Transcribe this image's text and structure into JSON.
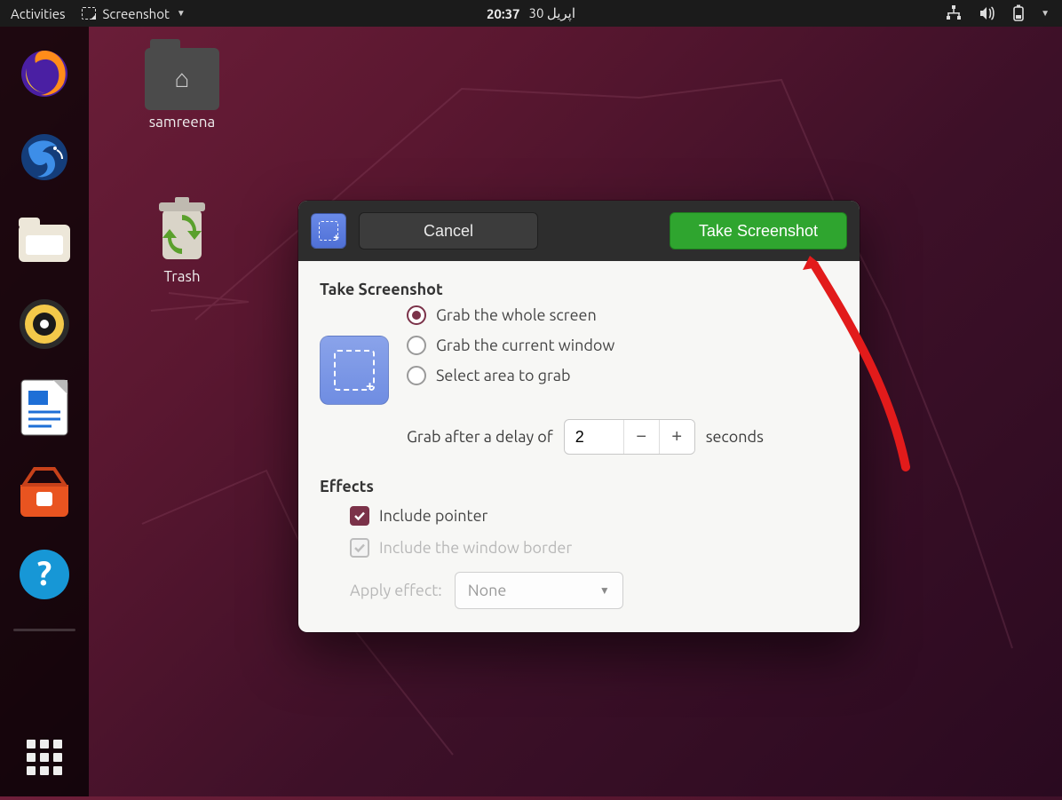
{
  "topbar": {
    "activities": "Activities",
    "app_name": "Screenshot",
    "time": "20:37",
    "date": "اپریل 30"
  },
  "desktop": {
    "home_folder_label": "samreena",
    "trash_label": "Trash"
  },
  "dialog": {
    "cancel": "Cancel",
    "take": "Take Screenshot",
    "section_capture": "Take Screenshot",
    "radio_whole": "Grab the whole screen",
    "radio_window": "Grab the current window",
    "radio_area": "Select area to grab",
    "delay_prefix": "Grab after a delay of",
    "delay_value": "2",
    "delay_suffix": "seconds",
    "section_effects": "Effects",
    "check_pointer": "Include pointer",
    "check_border": "Include the window border",
    "apply_effect_label": "Apply effect:",
    "apply_effect_value": "None"
  }
}
